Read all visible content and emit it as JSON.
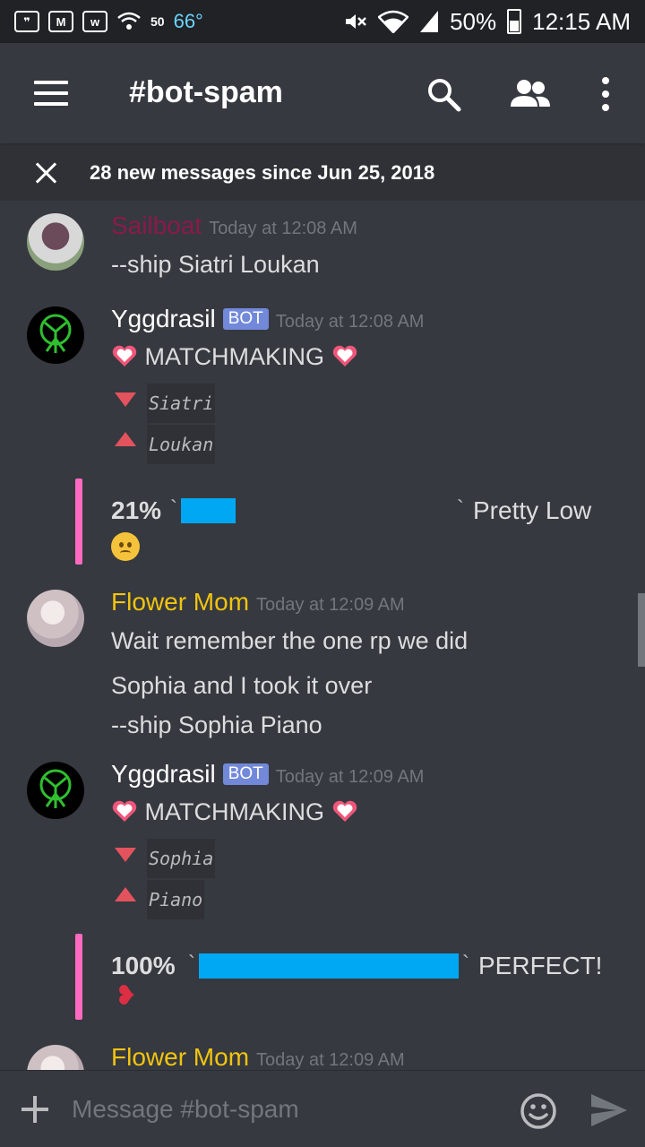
{
  "status_bar": {
    "temperature": "66°",
    "temp_small": "50",
    "battery": "50%",
    "time": "12:15 AM"
  },
  "header": {
    "channel": "#bot-spam"
  },
  "new_messages_bar": {
    "text": "28 new messages since Jun 25, 2018"
  },
  "messages": [
    {
      "author": "Sailboat",
      "author_color": "#8b1a4a",
      "timestamp": "Today at 12:08 AM",
      "lines": [
        "--ship Siatri Loukan"
      ]
    },
    {
      "author": "Yggdrasil",
      "author_color": "#ffffff",
      "bot_tag": "BOT",
      "timestamp": "Today at 12:08 AM",
      "title": "MATCHMAKING",
      "name_down": "Siatri",
      "name_up": "Loukan",
      "embed": {
        "percent": "21%",
        "rating": "Pretty Low",
        "value": 0.21,
        "tick": "`"
      }
    },
    {
      "author": "Flower Mom",
      "author_color": "#f1c40f",
      "timestamp": "Today at 12:09 AM",
      "lines": [
        "Wait remember the one rp we did",
        "Sophia and I took it over",
        "--ship Sophia Piano"
      ]
    },
    {
      "author": "Yggdrasil",
      "author_color": "#ffffff",
      "bot_tag": "BOT",
      "timestamp": "Today at 12:09 AM",
      "title": "MATCHMAKING",
      "name_down": "Sophia",
      "name_up": "Piano",
      "embed": {
        "percent": "100%",
        "rating": "PERFECT!",
        "value": 1.0,
        "tick": "`"
      }
    },
    {
      "author": "Flower Mom",
      "author_color": "#f1c40f",
      "timestamp": "Today at 12:09 AM"
    }
  ],
  "composer": {
    "placeholder": "Message #bot-spam"
  },
  "colors": {
    "background": "#36393f",
    "accent_bar": "#ff6ac1",
    "progress": "#00a8f3",
    "bot_tag": "#7289da"
  }
}
